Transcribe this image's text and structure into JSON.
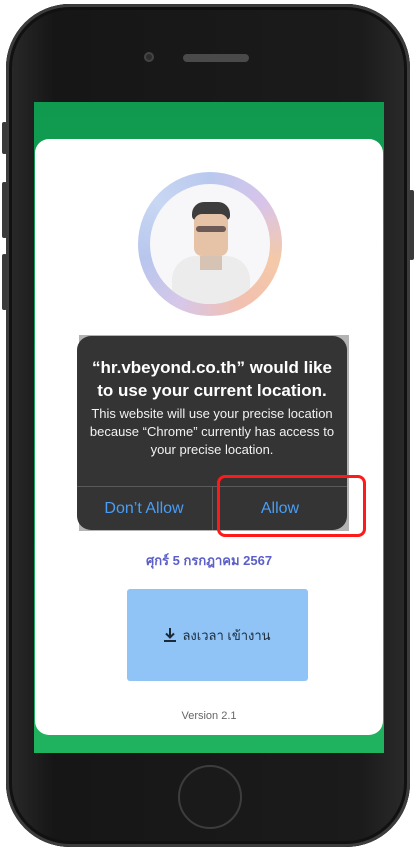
{
  "dialog": {
    "title": "“hr.vbeyond.co.th” would like to use your current location.",
    "message": "This website will use your precise location because “Chrome” currently has access to your precise location.",
    "dont_allow_label": "Don’t Allow",
    "allow_label": "Allow"
  },
  "page": {
    "date": "ศุกร์ 5 กรกฎาคม 2567",
    "checkin_label": "ลงเวลา เข้างาน",
    "version": "Version 2.1"
  },
  "icons": {
    "download": "download-icon",
    "avatar": "avatar"
  },
  "colors": {
    "header_green": "#0f9a4f",
    "button_blue": "#90c4f7",
    "date_purple": "#5b5fc7",
    "ios_link_blue": "#4a9df5",
    "highlight_red": "#ff1a1a"
  }
}
